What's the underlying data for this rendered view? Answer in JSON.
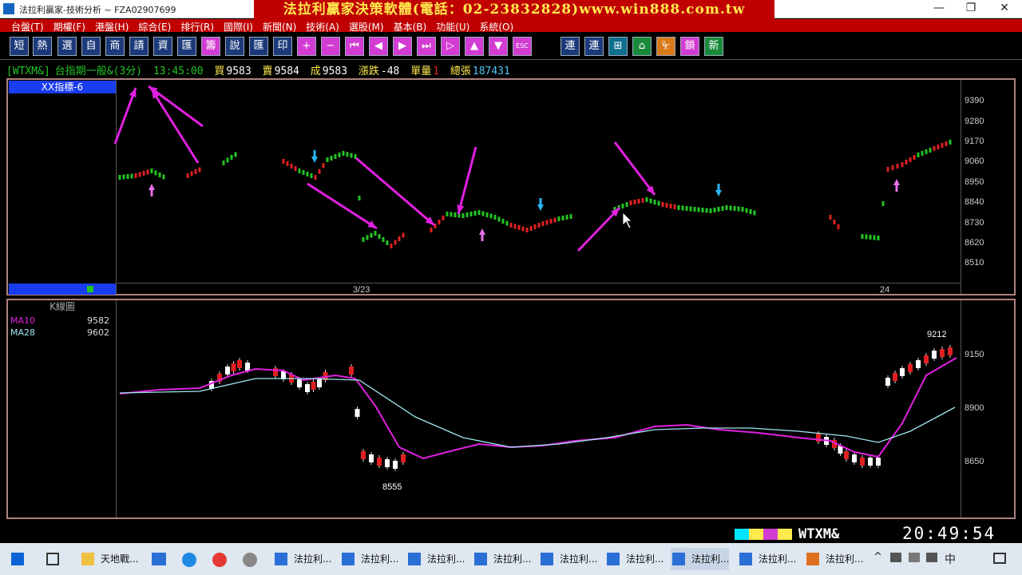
{
  "window": {
    "title": "法拉利贏家-技術分析 ~ FZA02907699",
    "banner": "法拉利贏家決策軟體(電話：02-23832828)www.win888.com.tw",
    "minimize": "—",
    "restore": "❐",
    "close": "✕"
  },
  "menu": [
    "台盤(T)",
    "期權(F)",
    "港盤(H)",
    "綜合(E)",
    "排行(R)",
    "國際(I)",
    "新聞(N)",
    "技術(A)",
    "選股(M)",
    "基本(B)",
    "功能(U)",
    "系統(O)"
  ],
  "toolbar": [
    "短",
    "熱",
    "選",
    "自",
    "商",
    "請",
    "資",
    "匯",
    "籌",
    "說",
    "匯",
    "印",
    "+",
    "−",
    "⏮",
    "◀",
    "▶",
    "⏭",
    "▷",
    "▲",
    "▼",
    "ESC",
    "連",
    "連",
    "⊞",
    "⌂",
    "⏧",
    "鎖",
    "新"
  ],
  "quote": {
    "symbol": "[WTXM&]",
    "name": "台指期一般&(3分)",
    "time": "13:45:00",
    "bid_label": "買",
    "bid": "9583",
    "ask_label": "賣",
    "ask": "9584",
    "trade_label": "成",
    "trade": "9583",
    "change_label": "漲跌",
    "change": "-48",
    "volume_label": "單量",
    "volume": "1",
    "total_label": "總張",
    "total": "187431"
  },
  "top_panel": {
    "indicator_label": "XX指標-6",
    "date_left": "3/23",
    "date_right": "24",
    "price_ticks": [
      "9390",
      "9280",
      "9170",
      "9060",
      "8950",
      "8840",
      "8730",
      "8620",
      "8510"
    ]
  },
  "bottom_panel": {
    "chart_label": "K線圖",
    "ma10_label": "MA10",
    "ma10_value": "9582",
    "ma28_label": "MA28",
    "ma28_value": "9602",
    "price_ticks": [
      "9150",
      "8900",
      "8650"
    ],
    "high_annotation": "9212",
    "low_annotation": "8555"
  },
  "status": {
    "symbol": "WTXM&",
    "clock": "20:49:54"
  },
  "taskbar": [
    "天地戰...",
    "法拉利...",
    "法拉利...",
    "法拉利...",
    "法拉利...",
    "法拉利...",
    "法拉利...",
    "法拉利...",
    "法拉利...",
    "法拉利..."
  ],
  "tray": {
    "ime": "中"
  },
  "colors": {
    "up": "#e02020",
    "down": "#22c422",
    "banner": "#c00000",
    "annotation": "#e020e0",
    "ma10": "#e020e0",
    "ma28": "#9fe8f0"
  }
}
